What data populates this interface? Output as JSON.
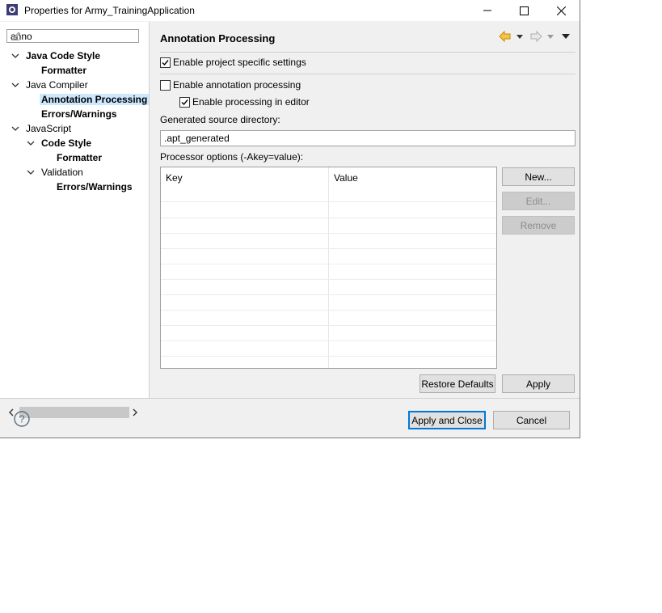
{
  "window": {
    "title": "Properties for Army_TrainingApplication"
  },
  "titlebar": {
    "minimize_icon": "minimize-icon",
    "maximize_icon": "maximize-icon",
    "close_icon": "close-icon"
  },
  "filter": {
    "value": "anno"
  },
  "tree": {
    "items": [
      {
        "label": "Java Code Style",
        "level": 0,
        "bold": true,
        "expanded": true
      },
      {
        "label": "Formatter",
        "level": 1,
        "bold": true
      },
      {
        "label": "Java Compiler",
        "level": 0,
        "bold": false,
        "expanded": true
      },
      {
        "label": "Annotation Processing",
        "level": 1,
        "bold": true,
        "selected": true
      },
      {
        "label": "Errors/Warnings",
        "level": 1,
        "bold": true
      },
      {
        "label": "JavaScript",
        "level": 0,
        "bold": false,
        "expanded": true
      },
      {
        "label": "Code Style",
        "level": 1,
        "bold": true,
        "expanded": true
      },
      {
        "label": "Formatter",
        "level": 2,
        "bold": true
      },
      {
        "label": "Validation",
        "level": 1,
        "bold": false,
        "expanded": true
      },
      {
        "label": "Errors/Warnings",
        "level": 2,
        "bold": true
      }
    ]
  },
  "page": {
    "title": "Annotation Processing",
    "enable_project_specific": {
      "label": "Enable project specific settings",
      "checked": true
    },
    "enable_annotation_processing": {
      "label": "Enable annotation processing",
      "checked": false
    },
    "enable_processing_in_editor": {
      "label": "Enable processing in editor",
      "checked": true
    },
    "generated_source_label": "Generated source directory:",
    "generated_source_value": ".apt_generated",
    "processor_options_label": "Processor options (-Akey=value):",
    "table": {
      "columns": [
        "Key",
        "Value"
      ]
    },
    "buttons": {
      "new": "New...",
      "edit": "Edit...",
      "remove": "Remove",
      "restore_defaults": "Restore Defaults",
      "apply": "Apply"
    }
  },
  "footer": {
    "apply_and_close": "Apply and Close",
    "cancel": "Cancel"
  },
  "colors": {
    "accent": "#0078d7",
    "selection": "#cce8ff",
    "back_arrow": "#e8a317"
  }
}
